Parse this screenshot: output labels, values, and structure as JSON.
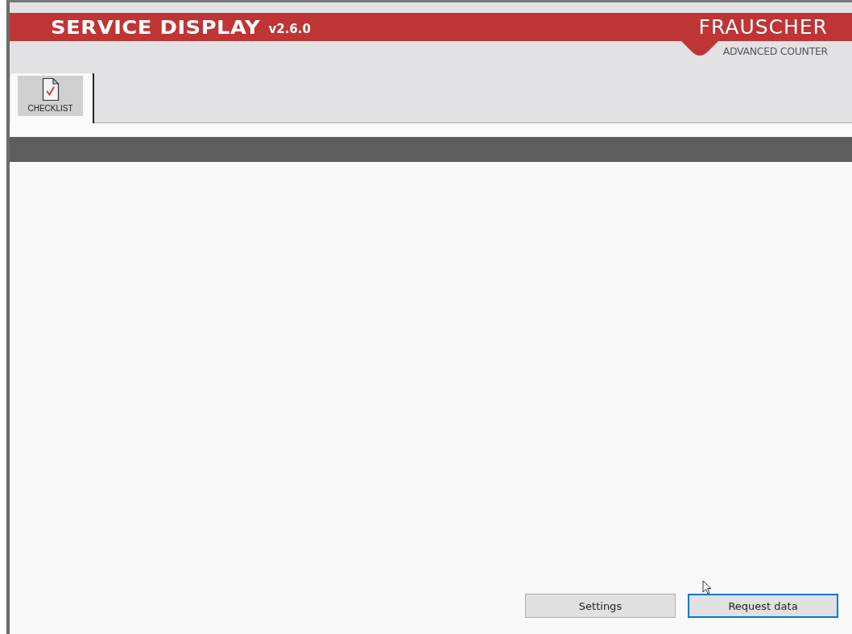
{
  "header": {
    "title": "SERVICE DISPLAY",
    "version": "v2.6.0",
    "brand": "FRAUSCHER",
    "tagline": "ADVANCED COUNTER"
  },
  "tabs": [
    {
      "label": "CHECKLIST",
      "selected": true
    }
  ],
  "buttons": [
    {
      "label": "Settings",
      "focused": false
    },
    {
      "label": "Request data",
      "focused": true
    }
  ]
}
